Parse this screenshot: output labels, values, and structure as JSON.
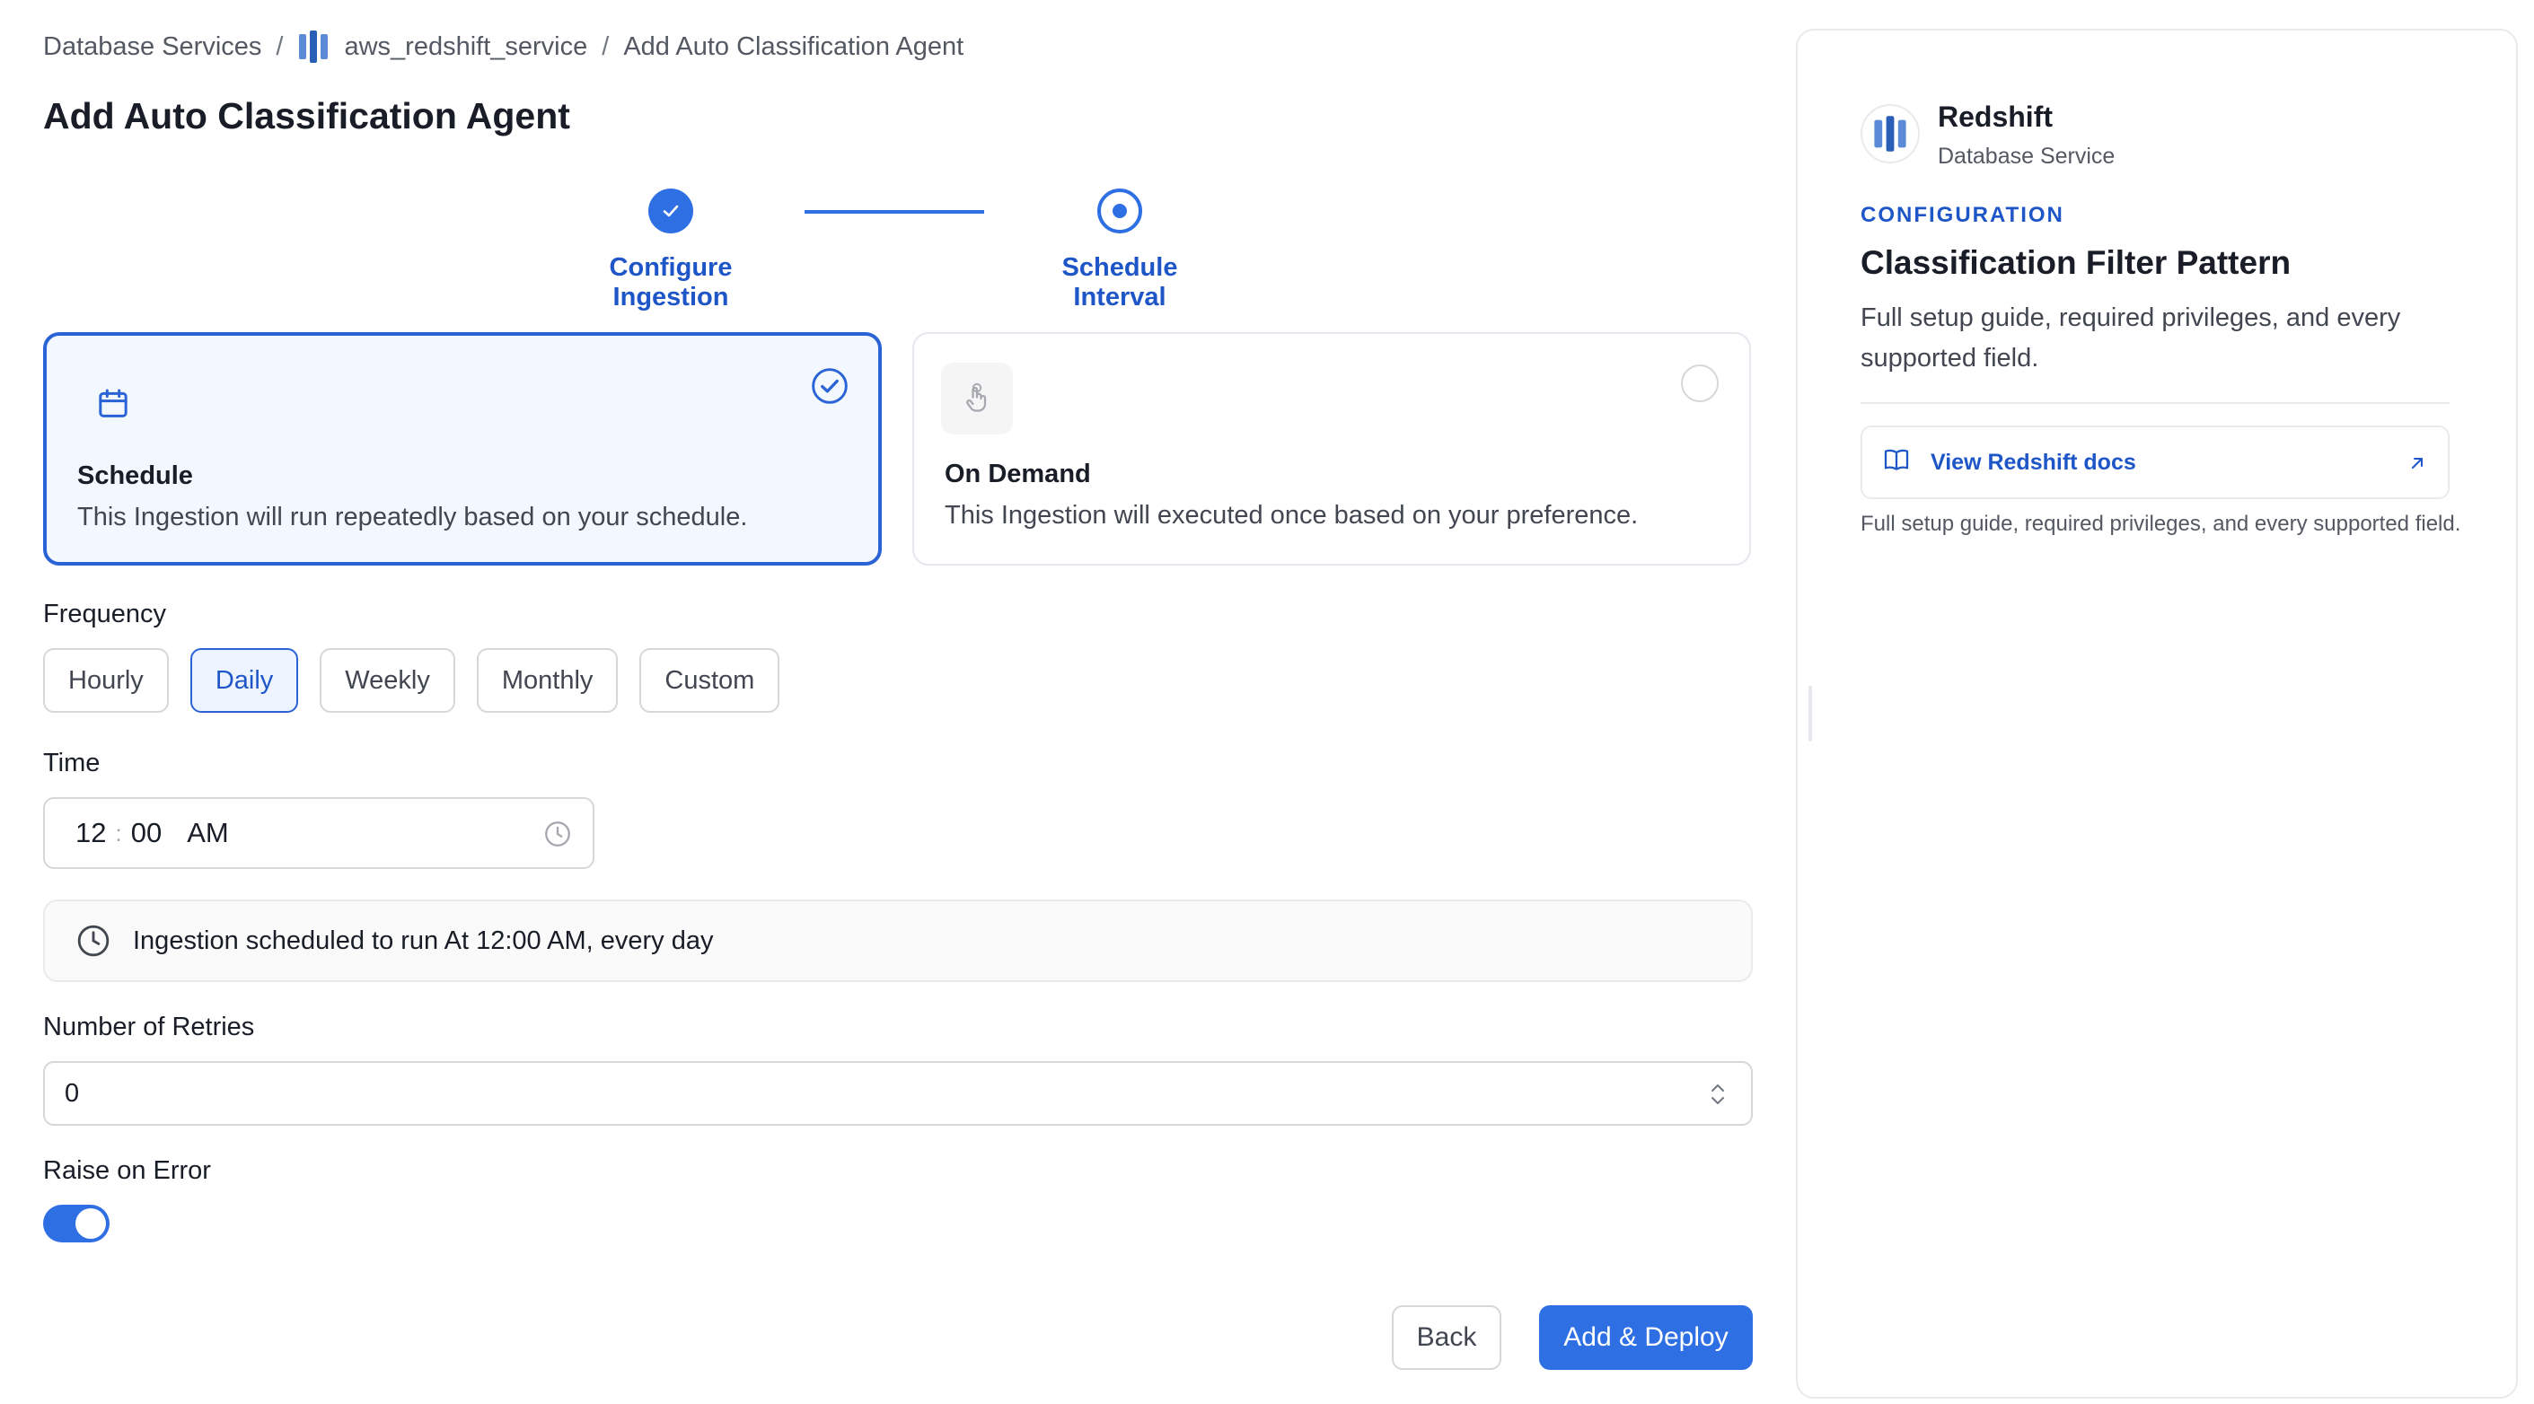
{
  "breadcrumb": {
    "items": [
      "Database Services",
      "aws_redshift_service",
      "Add Auto Classification Agent"
    ],
    "separator": "/"
  },
  "page_title": "Add Auto Classification Agent",
  "stepper": {
    "steps": [
      {
        "label": "Configure Ingestion",
        "state": "completed"
      },
      {
        "label": "Schedule Interval",
        "state": "active"
      }
    ]
  },
  "schedule_type": {
    "options": [
      {
        "title": "Schedule",
        "description": "This Ingestion will run repeatedly based on your schedule.",
        "icon": "calendar-icon",
        "selected": true
      },
      {
        "title": "On Demand",
        "description": "This Ingestion will executed once based on your preference.",
        "icon": "hand-pointer-icon",
        "selected": false
      }
    ]
  },
  "frequency": {
    "label": "Frequency",
    "options": [
      "Hourly",
      "Daily",
      "Weekly",
      "Monthly",
      "Custom"
    ],
    "selected": "Daily"
  },
  "time": {
    "label": "Time",
    "hour": "12",
    "minute": "00",
    "period": "AM"
  },
  "schedule_summary": "Ingestion scheduled to run At 12:00 AM, every day",
  "retries": {
    "label": "Number of Retries",
    "value": "0"
  },
  "raise_on_error": {
    "label": "Raise on Error",
    "enabled": true
  },
  "actions": {
    "back": "Back",
    "deploy": "Add & Deploy"
  },
  "side_panel": {
    "service_name": "Redshift",
    "service_type": "Database Service",
    "caption": "CONFIGURATION",
    "title": "Classification Filter Pattern",
    "description": "Full setup guide, required privileges, and every supported field.",
    "docs_link": "View Redshift docs",
    "docs_note": "Full setup guide, required privileges, and every supported field."
  },
  "colors": {
    "accent": "#2f6fe4",
    "accent_text": "#1e56c7",
    "selected_card_bg": "#f3f8ff"
  }
}
